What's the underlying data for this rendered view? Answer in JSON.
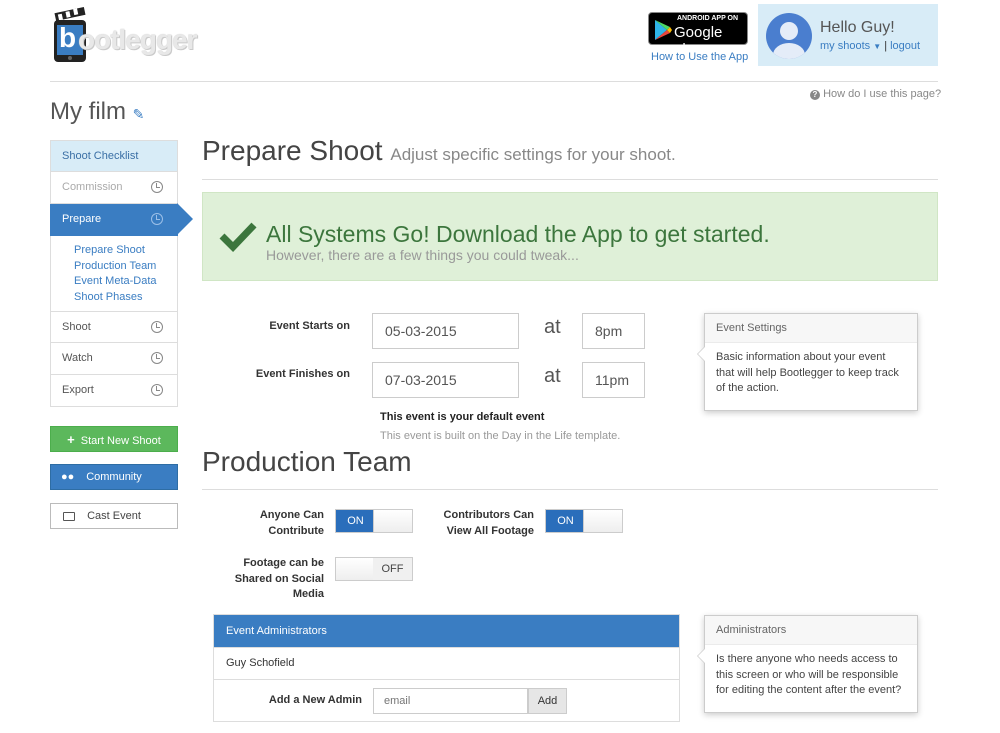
{
  "header": {
    "logo_text": "ootlegger",
    "logo_letter": "b",
    "google_play_small": "ANDROID APP ON",
    "google_play_big": "Google play",
    "how_to_link": "How to Use the App",
    "user": {
      "greeting": "Hello Guy!",
      "my_shoots": "my shoots",
      "separator": "|",
      "logout": "logout"
    },
    "help_link": "How do I use this page?"
  },
  "film_title": "My film",
  "sidebar": {
    "checklist_title": "Shoot Checklist",
    "items": [
      {
        "label": "Commission"
      },
      {
        "label": "Prepare"
      },
      {
        "label": "Shoot"
      },
      {
        "label": "Watch"
      },
      {
        "label": "Export"
      }
    ],
    "sub_items": [
      "Prepare Shoot",
      "Production Team",
      "Event Meta-Data",
      "Shoot Phases"
    ],
    "start_new_shoot": "Start New Shoot",
    "community": "Community",
    "cast_event": "Cast Event"
  },
  "prepare": {
    "title": "Prepare Shoot",
    "subtitle": "Adjust specific settings for your shoot.",
    "success_title": "All Systems Go! Download the App to get started.",
    "success_sub": "However, there are a few things you could tweak..."
  },
  "event": {
    "starts_label": "Event Starts on",
    "starts_date": "05-03-2015",
    "starts_time": "8pm",
    "finishes_label": "Event Finishes on",
    "finishes_date": "07-03-2015",
    "finishes_time": "11pm",
    "at_label": "at",
    "default_event": "This event is your default event",
    "template_note": "This event is built on the Day in the Life template.",
    "popover_title": "Event Settings",
    "popover_body": "Basic information about your event that will help Bootlegger to keep track of the action."
  },
  "production": {
    "title": "Production Team",
    "anyone_contribute_label": "Anyone Can Contribute",
    "anyone_contribute_state": "ON",
    "contributors_view_label": "Contributors Can View All Footage",
    "contributors_view_state": "ON",
    "footage_shared_label": "Footage can be Shared on Social Media",
    "footage_shared_state": "OFF"
  },
  "admins": {
    "panel_title": "Event Administrators",
    "list": [
      "Guy Schofield"
    ],
    "add_label": "Add a New Admin",
    "email_placeholder": "email",
    "add_button": "Add",
    "popover_title": "Administrators",
    "popover_body": "Is there anyone who needs access to this screen or who will be responsible for editing the content after the event?"
  },
  "colors": {
    "brand_blue": "#3a7dc2",
    "success_green": "#dff0d8",
    "button_green": "#5cb85c",
    "toggle_on": "#2a6ebb"
  }
}
